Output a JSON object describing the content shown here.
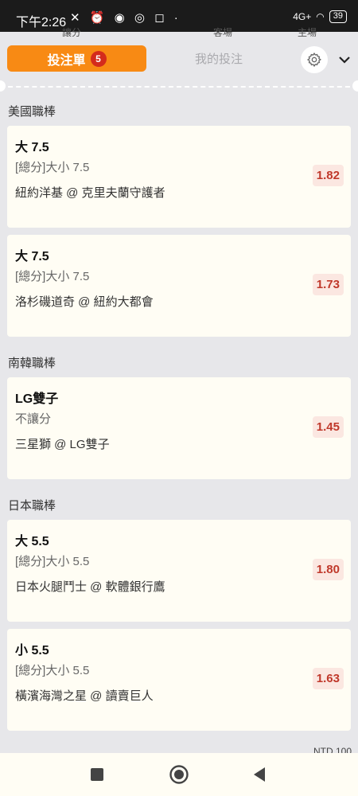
{
  "status_bar": {
    "time": "下午2:26",
    "battery": "39",
    "network": "4G+"
  },
  "behind_text": [
    "主場",
    "客場",
    "讓分"
  ],
  "header": {
    "tab_bet_slip": "投注單",
    "bet_count": "5",
    "tab_my_bets": "我的投注"
  },
  "sections": [
    {
      "title": "美國職棒",
      "bets": [
        {
          "pick": "大 7.5",
          "market": "[總分]大小 7.5",
          "match": "紐約洋基 @ 克里夫蘭守護者",
          "odds": "1.82"
        },
        {
          "pick": "大 7.5",
          "market": "[總分]大小 7.5",
          "match": "洛杉磯道奇 @ 紐約大都會",
          "odds": "1.73"
        }
      ]
    },
    {
      "title": "南韓職棒",
      "bets": [
        {
          "pick": "LG雙子",
          "market": "不讓分",
          "match": "三星獅 @ LG雙子",
          "odds": "1.45"
        }
      ]
    },
    {
      "title": "日本職棒",
      "bets": [
        {
          "pick": "大 5.5",
          "market": "[總分]大小 5.5",
          "match": "日本火腿鬥士 @ 軟體銀行鷹",
          "odds": "1.80"
        },
        {
          "pick": "小 5.5",
          "market": "[總分]大小 5.5",
          "match": "橫濱海灣之星 @ 讀賣巨人",
          "odds": "1.63"
        }
      ]
    }
  ],
  "footer_peek": "NTD 100",
  "colors": {
    "accent": "#f88a14",
    "badge": "#d42b1c",
    "odds_text": "#c0392b",
    "card_bg": "#fffdf4"
  }
}
